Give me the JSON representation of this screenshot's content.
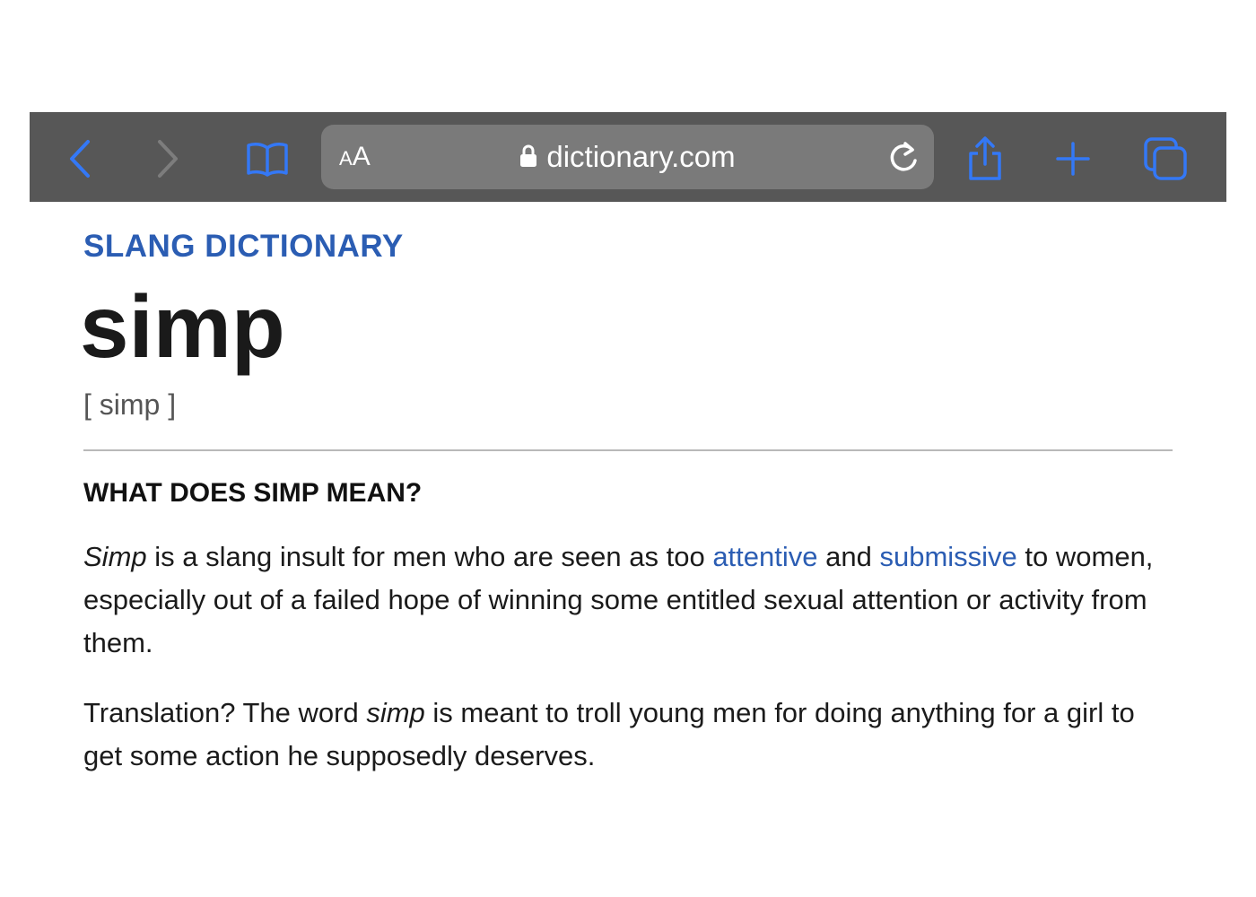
{
  "browser": {
    "url": "dictionary.com",
    "text_size_label": "AA",
    "accent_color": "#3478f6",
    "icons": [
      "back-icon",
      "forward-icon",
      "bookmarks-icon",
      "lock-icon",
      "reload-icon",
      "share-icon",
      "new-tab-icon",
      "tabs-icon"
    ]
  },
  "page": {
    "kicker": "SLANG DICTIONARY",
    "headword": "simp",
    "pronunciation": "[ simp ]",
    "section_title": "WHAT DOES SIMP MEAN?",
    "para1": {
      "em": "Simp",
      "t1": " is a slang insult for men who are seen as too ",
      "link1": "attentive",
      "t2": " and ",
      "link2": "submissive",
      "t3": " to women, especially out of a failed hope of winning some entitled sexual attention or activity from them."
    },
    "para2": {
      "t1": "Translation? The word ",
      "em": "simp",
      "t2": " is meant to troll young men for doing anything for a girl to get some action he supposedly deserves."
    },
    "link_color": "#2b5db3"
  }
}
